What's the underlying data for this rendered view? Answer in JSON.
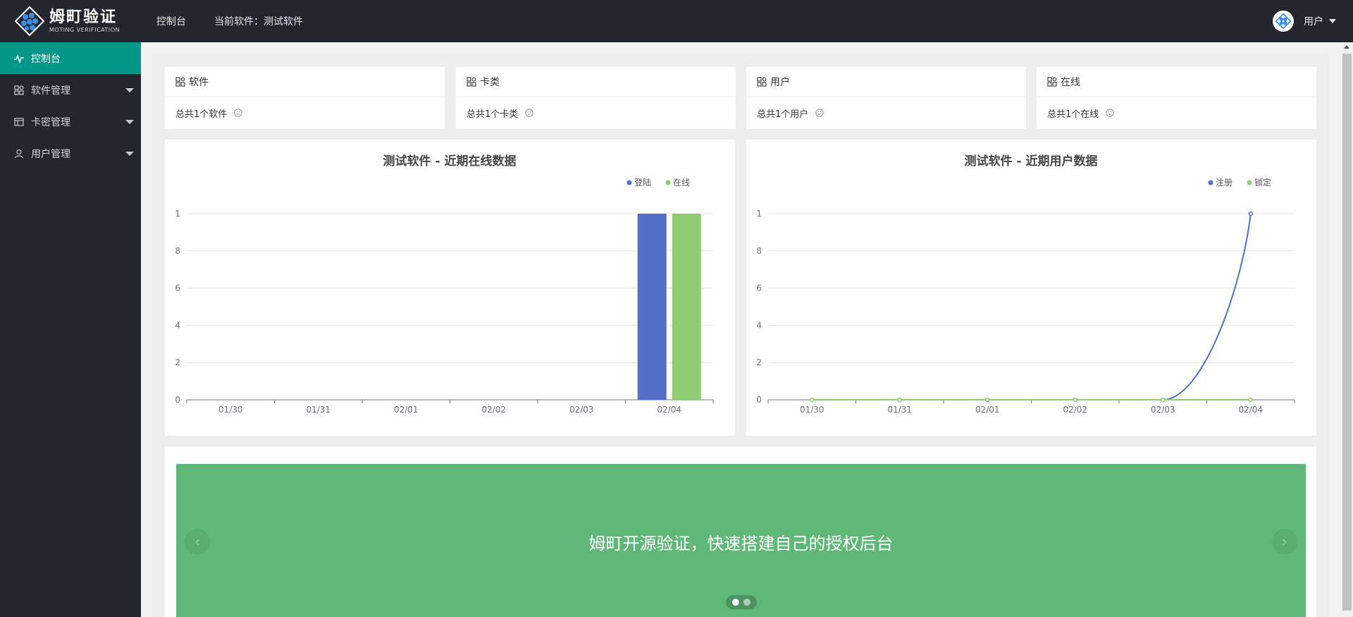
{
  "header": {
    "logo_title": "姆町验证",
    "logo_sub": "MOTING VERIFICATION",
    "nav": [
      "控制台",
      "当前软件：测试软件"
    ],
    "user_label": "用户"
  },
  "sidebar": {
    "items": [
      {
        "label": "控制台",
        "icon": "pulse-icon",
        "active": true
      },
      {
        "label": "软件管理",
        "icon": "apps-icon",
        "expandable": true
      },
      {
        "label": "卡密管理",
        "icon": "card-icon",
        "expandable": true
      },
      {
        "label": "用户管理",
        "icon": "user-icon",
        "expandable": true
      }
    ]
  },
  "stats": [
    {
      "title": "软件",
      "text": "总共1个软件"
    },
    {
      "title": "卡类",
      "text": "总共1个卡类"
    },
    {
      "title": "用户",
      "text": "总共1个用户"
    },
    {
      "title": "在线",
      "text": "总共1个在线"
    }
  ],
  "chart_data": [
    {
      "type": "bar",
      "title": "测试软件 - 近期在线数据",
      "categories": [
        "01/30",
        "01/31",
        "02/01",
        "02/02",
        "02/03",
        "02/04"
      ],
      "y_tick_labels": [
        "0",
        "2",
        "4",
        "6",
        "8",
        "1"
      ],
      "ylim": [
        0,
        1
      ],
      "grid": true,
      "legend_position": "top-right",
      "series": [
        {
          "name": "登陆",
          "color": "#5470c6",
          "values": [
            0,
            0,
            0,
            0,
            0,
            1
          ]
        },
        {
          "name": "在线",
          "color": "#91cc75",
          "values": [
            0,
            0,
            0,
            0,
            0,
            1
          ]
        }
      ]
    },
    {
      "type": "line",
      "title": "测试软件 - 近期用户数据",
      "categories": [
        "01/30",
        "01/31",
        "02/01",
        "02/02",
        "02/03",
        "02/04"
      ],
      "y_tick_labels": [
        "0",
        "2",
        "4",
        "6",
        "8",
        "1"
      ],
      "ylim": [
        0,
        1
      ],
      "grid": true,
      "smooth": true,
      "legend_position": "top-right",
      "series": [
        {
          "name": "注册",
          "color": "#5470c6",
          "values": [
            0,
            0,
            0,
            0,
            0,
            1
          ]
        },
        {
          "name": "锁定",
          "color": "#91cc75",
          "values": [
            0,
            0,
            0,
            0,
            0,
            0
          ]
        }
      ]
    }
  ],
  "banner": {
    "text": "姆町开源验证，快速搭建自己的授权后台",
    "slides": 2,
    "active_slide": 0,
    "prev_icon": "chevron-left-icon",
    "next_icon": "chevron-right-icon"
  },
  "colors": {
    "header_bg": "#23262e",
    "active_menu": "#009688",
    "banner_bg": "#5fb878"
  }
}
